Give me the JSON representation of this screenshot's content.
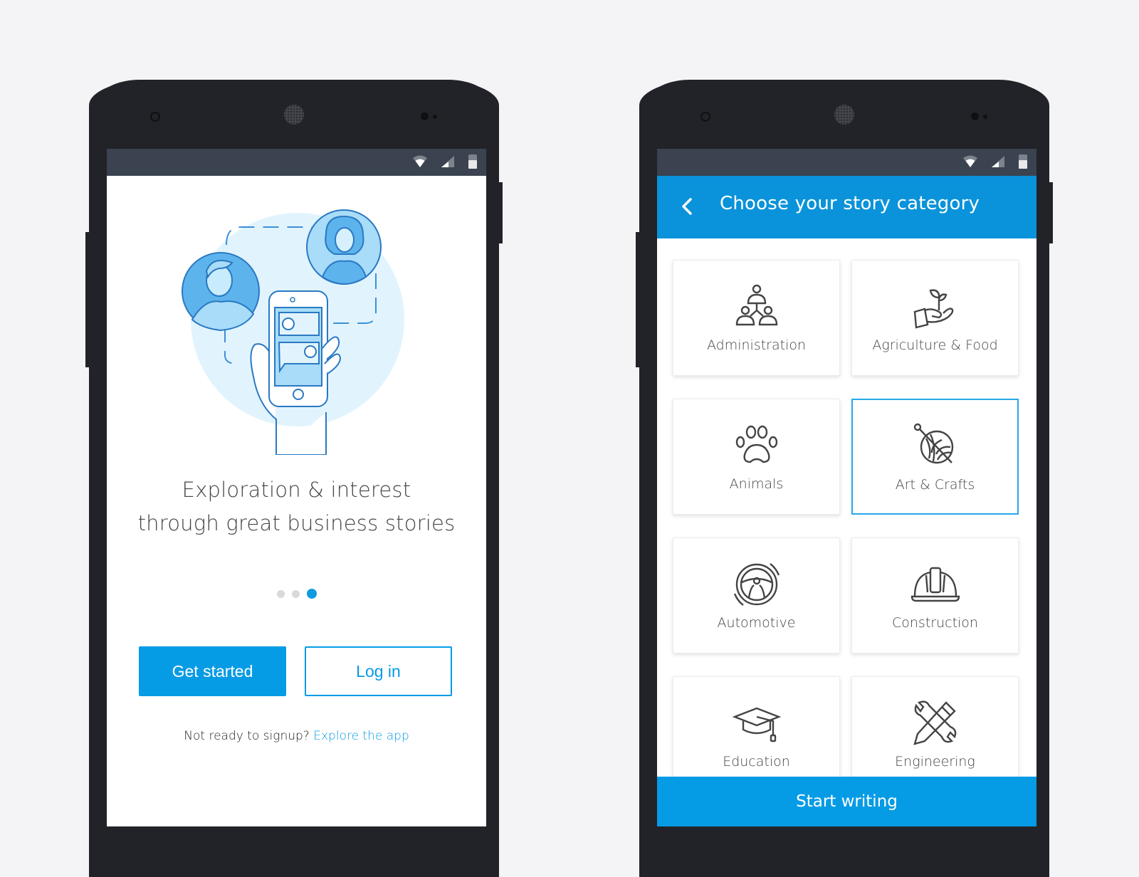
{
  "colors": {
    "accent": "#069be5",
    "appbar": "#0a93da",
    "statusbar": "#3a434f",
    "phone_body": "#222328",
    "background": "#f4f4f6"
  },
  "status_bar": {
    "icons": [
      "wifi-icon",
      "signal-icon",
      "battery-icon"
    ]
  },
  "onboarding": {
    "illustration": "two-people-chatting-via-phone",
    "headline_line1": "Exploration & interest",
    "headline_line2": "through great business stories",
    "pager": {
      "total": 3,
      "active": 3
    },
    "get_started_label": "Get started",
    "login_label": "Log in",
    "not_ready_text": "Not ready to signup?",
    "explore_link": "Explore the app"
  },
  "category_screen": {
    "back_icon": "chevron-left-icon",
    "title": "Choose your story category",
    "categories": [
      {
        "label": "Administration",
        "icon": "people-hierarchy-icon",
        "selected": false
      },
      {
        "label": "Agriculture & Food",
        "icon": "hand-plant-icon",
        "selected": false
      },
      {
        "label": "Animals",
        "icon": "paw-icon",
        "selected": false
      },
      {
        "label": "Art & Crafts",
        "icon": "yarn-ball-icon",
        "selected": true
      },
      {
        "label": "Automotive",
        "icon": "steering-wheel-icon",
        "selected": false
      },
      {
        "label": "Construction",
        "icon": "hard-hat-icon",
        "selected": false
      },
      {
        "label": "Education",
        "icon": "graduation-cap-icon",
        "selected": false
      },
      {
        "label": "Engineering",
        "icon": "wrench-pencil-icon",
        "selected": false
      }
    ],
    "start_button_label": "Start writing"
  }
}
